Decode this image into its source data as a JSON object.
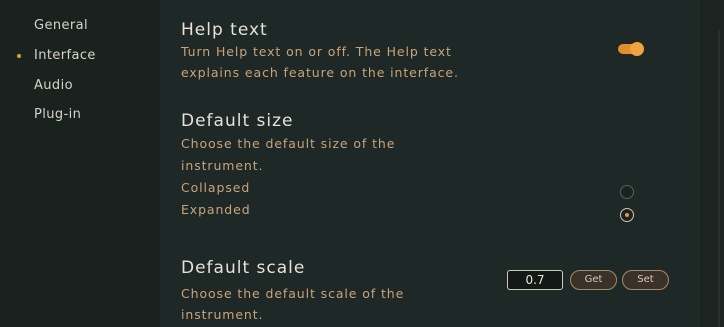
{
  "sidebar": {
    "items": [
      {
        "label": "General",
        "active": false
      },
      {
        "label": "Interface",
        "active": true
      },
      {
        "label": "Audio",
        "active": false
      },
      {
        "label": "Plug-in",
        "active": false
      }
    ]
  },
  "help_text": {
    "title": "Help text",
    "description_line1": "Turn Help text on or off. The Help text",
    "description_line2": "explains each feature on the interface.",
    "enabled": true
  },
  "default_size": {
    "title": "Default size",
    "description_line1": "Choose the default size of the",
    "description_line2": "instrument.",
    "options": [
      {
        "label": "Collapsed",
        "selected": false
      },
      {
        "label": "Expanded",
        "selected": true
      }
    ]
  },
  "default_scale": {
    "title": "Default scale",
    "description_line1": "Choose the default scale of the",
    "description_line2": "instrument.",
    "value": "0.7",
    "get_label": "Get",
    "set_label": "Set"
  },
  "colors": {
    "accent": "#e49a3c",
    "background": "#1e2826",
    "heading": "#e7e1d6",
    "description": "#c9a37a"
  }
}
